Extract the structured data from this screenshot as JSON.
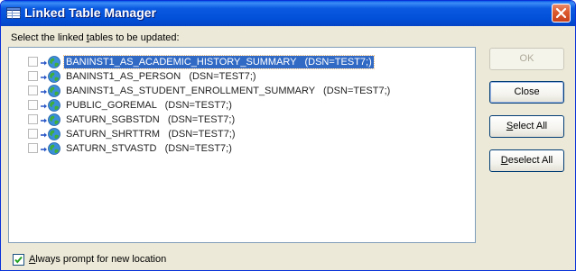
{
  "window": {
    "title": "Linked Table Manager",
    "prompt_prefix": "Select the linked ",
    "prompt_underlined": "t",
    "prompt_suffix": "ables to be updated:"
  },
  "tables": [
    {
      "label": "BANINST1_AS_ACADEMIC_HISTORY_SUMMARY   (DSN=TEST7;)",
      "checked": false,
      "selected": true
    },
    {
      "label": "BANINST1_AS_PERSON   (DSN=TEST7;)",
      "checked": false,
      "selected": false
    },
    {
      "label": "BANINST1_AS_STUDENT_ENROLLMENT_SUMMARY   (DSN=TEST7;)",
      "checked": false,
      "selected": false
    },
    {
      "label": "PUBLIC_GOREMAL   (DSN=TEST7;)",
      "checked": false,
      "selected": false
    },
    {
      "label": "SATURN_SGBSTDN   (DSN=TEST7;)",
      "checked": false,
      "selected": false
    },
    {
      "label": "SATURN_SHRTTRM   (DSN=TEST7;)",
      "checked": false,
      "selected": false
    },
    {
      "label": "SATURN_STVASTD   (DSN=TEST7;)",
      "checked": false,
      "selected": false
    }
  ],
  "buttons": {
    "ok": "OK",
    "close": "Close",
    "select_all_underlined": "S",
    "select_all_rest": "elect All",
    "deselect_all_underlined": "D",
    "deselect_all_rest": "eselect All"
  },
  "footer": {
    "checked": true,
    "label_underlined": "A",
    "label_rest": "lways prompt for new location"
  },
  "icons": {
    "title": "table-icon",
    "row": "linked-table-globe-icon",
    "close": "close-icon"
  },
  "colors": {
    "titlebar": "#0a59e0",
    "selection": "#316ac5",
    "close_button": "#dd5a2e"
  }
}
